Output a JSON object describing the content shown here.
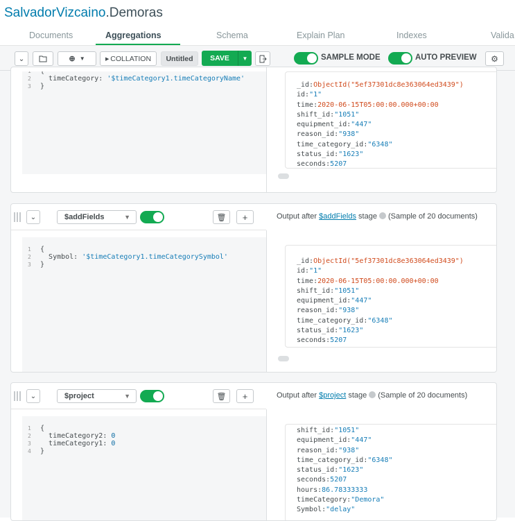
{
  "title": {
    "owner": "SalvadorVizcaino",
    "dot": ".",
    "collection": "Demoras"
  },
  "tabs": [
    "Documents",
    "Aggregations",
    "Schema",
    "Explain Plan",
    "Indexes",
    "Valida"
  ],
  "toolbar": {
    "collapse_icon": "chevron-down-icon",
    "open_icon": "folder-open-icon",
    "add_icon": "plus-circle-icon",
    "collation": "COLLATION",
    "pipeline_name": "Untitled",
    "save": "SAVE",
    "export_icon": "export-icon",
    "sample_mode": "SAMPLE MODE",
    "auto_preview": "AUTO PREVIEW",
    "settings_icon": "gear-icon"
  },
  "stage1": {
    "code": [
      {
        "n": "1",
        "t": "{"
      },
      {
        "n": "2",
        "k": "timeCategory: ",
        "v": "'$timeCategory1.timeCategoryName'"
      },
      {
        "n": "3",
        "t": "}"
      }
    ],
    "doc": [
      {
        "k": "_id:",
        "v": "ObjectId(\"5ef37301dc8e363064ed3439\")",
        "c": "oid"
      },
      {
        "k": "id:",
        "v": "\"1\"",
        "c": "s"
      },
      {
        "k": "time:",
        "v": "2020-06-15T05:00:00.000+00:00",
        "c": "d"
      },
      {
        "k": "shift_id:",
        "v": "\"1051\"",
        "c": "s"
      },
      {
        "k": "equipment_id:",
        "v": "\"447\"",
        "c": "s"
      },
      {
        "k": "reason_id:",
        "v": "\"938\"",
        "c": "s"
      },
      {
        "k": "time_category_id:",
        "v": "\"6348\"",
        "c": "s"
      },
      {
        "k": "status_id:",
        "v": "\"1623\"",
        "c": "s"
      },
      {
        "k": "seconds:",
        "v": "5207",
        "c": "n"
      }
    ]
  },
  "stage2": {
    "operator": "$addFields",
    "output_prefix": "Output after ",
    "output_link": "$addFields",
    "output_suffix": " stage",
    "sample": "(Sample of 20 documents)",
    "code": [
      {
        "n": "1",
        "t": "{"
      },
      {
        "n": "2",
        "k": "Symbol: ",
        "v": "'$timeCategory1.timeCategorySymbol'"
      },
      {
        "n": "3",
        "t": "}"
      }
    ],
    "doc": [
      {
        "k": "_id:",
        "v": "ObjectId(\"5ef37301dc8e363064ed3439\")",
        "c": "oid"
      },
      {
        "k": "id:",
        "v": "\"1\"",
        "c": "s"
      },
      {
        "k": "time:",
        "v": "2020-06-15T05:00:00.000+00:00",
        "c": "d"
      },
      {
        "k": "shift_id:",
        "v": "\"1051\"",
        "c": "s"
      },
      {
        "k": "equipment_id:",
        "v": "\"447\"",
        "c": "s"
      },
      {
        "k": "reason_id:",
        "v": "\"938\"",
        "c": "s"
      },
      {
        "k": "time_category_id:",
        "v": "\"6348\"",
        "c": "s"
      },
      {
        "k": "status_id:",
        "v": "\"1623\"",
        "c": "s"
      },
      {
        "k": "seconds:",
        "v": "5207",
        "c": "n"
      }
    ]
  },
  "stage3": {
    "operator": "$project",
    "output_prefix": "Output after ",
    "output_link": "$project",
    "output_suffix": " stage",
    "sample": "(Sample of 20 documents)",
    "code": [
      {
        "n": "1",
        "t": "{"
      },
      {
        "n": "2",
        "k": "timeCategory2: ",
        "v": "0"
      },
      {
        "n": "3",
        "k": "timeCategory1: ",
        "v": "0"
      },
      {
        "n": "4",
        "t": "}"
      }
    ],
    "doc": [
      {
        "k": "shift_id:",
        "v": "\"1051\"",
        "c": "s"
      },
      {
        "k": "equipment_id:",
        "v": "\"447\"",
        "c": "s"
      },
      {
        "k": "reason_id:",
        "v": "\"938\"",
        "c": "s"
      },
      {
        "k": "time_category_id:",
        "v": "\"6348\"",
        "c": "s"
      },
      {
        "k": "status_id:",
        "v": "\"1623\"",
        "c": "s"
      },
      {
        "k": "seconds:",
        "v": "5207",
        "c": "n"
      },
      {
        "k": "hours:",
        "v": "86.78333333",
        "c": "n"
      },
      {
        "k": "timeCategory:",
        "v": "\"Demora\"",
        "c": "s"
      },
      {
        "k": "Symbol:",
        "v": "\"delay\"",
        "c": "s"
      }
    ]
  },
  "colors": {
    "accent": "#13aa52",
    "link": "#007cad",
    "oid": "#d04a1c",
    "string": "#167db7"
  }
}
